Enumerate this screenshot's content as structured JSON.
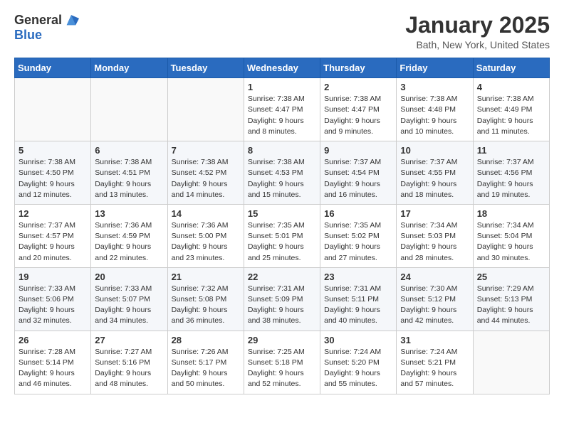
{
  "header": {
    "logo_general": "General",
    "logo_blue": "Blue",
    "month": "January 2025",
    "location": "Bath, New York, United States"
  },
  "weekdays": [
    "Sunday",
    "Monday",
    "Tuesday",
    "Wednesday",
    "Thursday",
    "Friday",
    "Saturday"
  ],
  "weeks": [
    [
      {
        "day": "",
        "info": ""
      },
      {
        "day": "",
        "info": ""
      },
      {
        "day": "",
        "info": ""
      },
      {
        "day": "1",
        "info": "Sunrise: 7:38 AM\nSunset: 4:47 PM\nDaylight: 9 hours\nand 8 minutes."
      },
      {
        "day": "2",
        "info": "Sunrise: 7:38 AM\nSunset: 4:47 PM\nDaylight: 9 hours\nand 9 minutes."
      },
      {
        "day": "3",
        "info": "Sunrise: 7:38 AM\nSunset: 4:48 PM\nDaylight: 9 hours\nand 10 minutes."
      },
      {
        "day": "4",
        "info": "Sunrise: 7:38 AM\nSunset: 4:49 PM\nDaylight: 9 hours\nand 11 minutes."
      }
    ],
    [
      {
        "day": "5",
        "info": "Sunrise: 7:38 AM\nSunset: 4:50 PM\nDaylight: 9 hours\nand 12 minutes."
      },
      {
        "day": "6",
        "info": "Sunrise: 7:38 AM\nSunset: 4:51 PM\nDaylight: 9 hours\nand 13 minutes."
      },
      {
        "day": "7",
        "info": "Sunrise: 7:38 AM\nSunset: 4:52 PM\nDaylight: 9 hours\nand 14 minutes."
      },
      {
        "day": "8",
        "info": "Sunrise: 7:38 AM\nSunset: 4:53 PM\nDaylight: 9 hours\nand 15 minutes."
      },
      {
        "day": "9",
        "info": "Sunrise: 7:37 AM\nSunset: 4:54 PM\nDaylight: 9 hours\nand 16 minutes."
      },
      {
        "day": "10",
        "info": "Sunrise: 7:37 AM\nSunset: 4:55 PM\nDaylight: 9 hours\nand 18 minutes."
      },
      {
        "day": "11",
        "info": "Sunrise: 7:37 AM\nSunset: 4:56 PM\nDaylight: 9 hours\nand 19 minutes."
      }
    ],
    [
      {
        "day": "12",
        "info": "Sunrise: 7:37 AM\nSunset: 4:57 PM\nDaylight: 9 hours\nand 20 minutes."
      },
      {
        "day": "13",
        "info": "Sunrise: 7:36 AM\nSunset: 4:59 PM\nDaylight: 9 hours\nand 22 minutes."
      },
      {
        "day": "14",
        "info": "Sunrise: 7:36 AM\nSunset: 5:00 PM\nDaylight: 9 hours\nand 23 minutes."
      },
      {
        "day": "15",
        "info": "Sunrise: 7:35 AM\nSunset: 5:01 PM\nDaylight: 9 hours\nand 25 minutes."
      },
      {
        "day": "16",
        "info": "Sunrise: 7:35 AM\nSunset: 5:02 PM\nDaylight: 9 hours\nand 27 minutes."
      },
      {
        "day": "17",
        "info": "Sunrise: 7:34 AM\nSunset: 5:03 PM\nDaylight: 9 hours\nand 28 minutes."
      },
      {
        "day": "18",
        "info": "Sunrise: 7:34 AM\nSunset: 5:04 PM\nDaylight: 9 hours\nand 30 minutes."
      }
    ],
    [
      {
        "day": "19",
        "info": "Sunrise: 7:33 AM\nSunset: 5:06 PM\nDaylight: 9 hours\nand 32 minutes."
      },
      {
        "day": "20",
        "info": "Sunrise: 7:33 AM\nSunset: 5:07 PM\nDaylight: 9 hours\nand 34 minutes."
      },
      {
        "day": "21",
        "info": "Sunrise: 7:32 AM\nSunset: 5:08 PM\nDaylight: 9 hours\nand 36 minutes."
      },
      {
        "day": "22",
        "info": "Sunrise: 7:31 AM\nSunset: 5:09 PM\nDaylight: 9 hours\nand 38 minutes."
      },
      {
        "day": "23",
        "info": "Sunrise: 7:31 AM\nSunset: 5:11 PM\nDaylight: 9 hours\nand 40 minutes."
      },
      {
        "day": "24",
        "info": "Sunrise: 7:30 AM\nSunset: 5:12 PM\nDaylight: 9 hours\nand 42 minutes."
      },
      {
        "day": "25",
        "info": "Sunrise: 7:29 AM\nSunset: 5:13 PM\nDaylight: 9 hours\nand 44 minutes."
      }
    ],
    [
      {
        "day": "26",
        "info": "Sunrise: 7:28 AM\nSunset: 5:14 PM\nDaylight: 9 hours\nand 46 minutes."
      },
      {
        "day": "27",
        "info": "Sunrise: 7:27 AM\nSunset: 5:16 PM\nDaylight: 9 hours\nand 48 minutes."
      },
      {
        "day": "28",
        "info": "Sunrise: 7:26 AM\nSunset: 5:17 PM\nDaylight: 9 hours\nand 50 minutes."
      },
      {
        "day": "29",
        "info": "Sunrise: 7:25 AM\nSunset: 5:18 PM\nDaylight: 9 hours\nand 52 minutes."
      },
      {
        "day": "30",
        "info": "Sunrise: 7:24 AM\nSunset: 5:20 PM\nDaylight: 9 hours\nand 55 minutes."
      },
      {
        "day": "31",
        "info": "Sunrise: 7:24 AM\nSunset: 5:21 PM\nDaylight: 9 hours\nand 57 minutes."
      },
      {
        "day": "",
        "info": ""
      }
    ]
  ]
}
